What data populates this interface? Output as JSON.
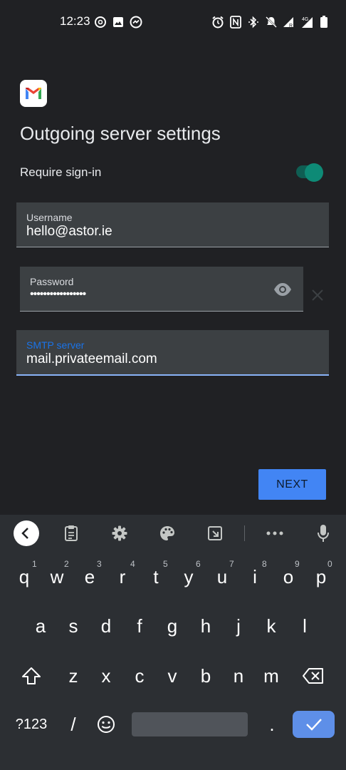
{
  "status_bar": {
    "time": "12:23",
    "left_icons": [
      "threads-icon",
      "gallery-icon",
      "messenger-icon"
    ],
    "right_icons": [
      "alarm-icon",
      "nfc-icon",
      "bluetooth-icon",
      "dnd-icon",
      "signal-r-icon",
      "signal-4g-icon",
      "battery-icon"
    ]
  },
  "app": {
    "title": "Outgoing server settings",
    "require_signin": {
      "label": "Require sign-in",
      "enabled": true
    },
    "username": {
      "label": "Username",
      "value": "hello@astor.ie"
    },
    "password": {
      "label": "Password",
      "value": "•••••••••••••••••"
    },
    "smtp": {
      "label": "SMTP server",
      "value": "mail.privateemail.com"
    },
    "next_label": "NEXT"
  },
  "keyboard": {
    "row1": [
      {
        "k": "q",
        "h": "1"
      },
      {
        "k": "w",
        "h": "2"
      },
      {
        "k": "e",
        "h": "3"
      },
      {
        "k": "r",
        "h": "4"
      },
      {
        "k": "t",
        "h": "5"
      },
      {
        "k": "y",
        "h": "6"
      },
      {
        "k": "u",
        "h": "7"
      },
      {
        "k": "i",
        "h": "8"
      },
      {
        "k": "o",
        "h": "9"
      },
      {
        "k": "p",
        "h": "0"
      }
    ],
    "row2": [
      "a",
      "s",
      "d",
      "f",
      "g",
      "h",
      "j",
      "k",
      "l"
    ],
    "row3": [
      "z",
      "x",
      "c",
      "v",
      "b",
      "n",
      "m"
    ],
    "symbols_label": "?123",
    "slash_label": "/",
    "period_label": "."
  },
  "colors": {
    "accent": "#4285f4",
    "toggle": "#0e8a76",
    "background": "#202124"
  }
}
